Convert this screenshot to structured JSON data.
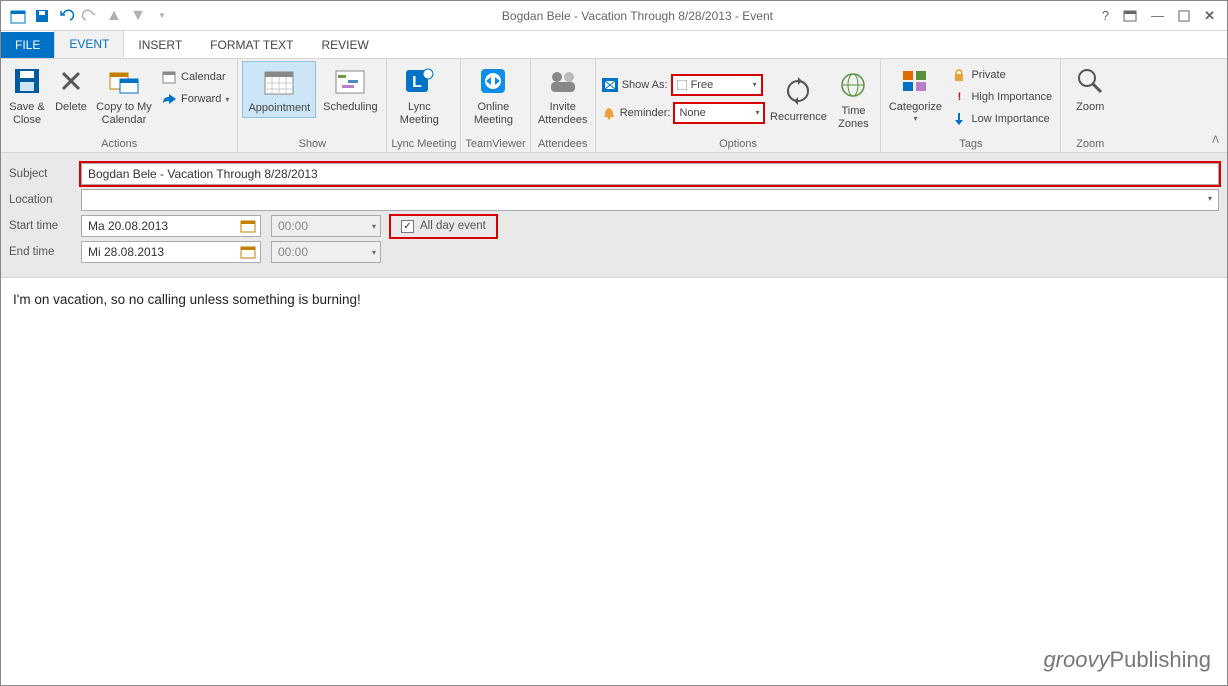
{
  "window": {
    "title": "Bogdan Bele - Vacation Through 8/28/2013 - Event"
  },
  "tabs": {
    "file": "FILE",
    "event": "EVENT",
    "insert": "INSERT",
    "format_text": "FORMAT TEXT",
    "review": "REVIEW"
  },
  "ribbon": {
    "actions": {
      "save_close": "Save & Close",
      "delete": "Delete",
      "copy_cal": "Copy to My Calendar",
      "calendar": "Calendar",
      "forward": "Forward",
      "group": "Actions"
    },
    "show": {
      "appointment": "Appointment",
      "scheduling": "Scheduling",
      "group": "Show"
    },
    "lync": {
      "label": "Lync Meeting",
      "group": "Lync Meeting"
    },
    "online": {
      "label": "Online Meeting",
      "group": "TeamViewer"
    },
    "attendees": {
      "label": "Invite Attendees",
      "group": "Attendees"
    },
    "options": {
      "show_as_label": "Show As:",
      "show_as_value": "Free",
      "reminder_label": "Reminder:",
      "reminder_value": "None",
      "recurrence": "Recurrence",
      "time_zones": "Time Zones",
      "group": "Options"
    },
    "tags": {
      "categorize": "Categorize",
      "private": "Private",
      "high": "High Importance",
      "low": "Low Importance",
      "group": "Tags"
    },
    "zoom": {
      "label": "Zoom",
      "group": "Zoom"
    }
  },
  "form": {
    "subject_label": "Subject",
    "subject_value": "Bogdan Bele - Vacation Through 8/28/2013",
    "location_label": "Location",
    "location_value": "",
    "start_label": "Start time",
    "start_date": "Ma 20.08.2013",
    "start_time": "00:00",
    "end_label": "End time",
    "end_date": "Mi 28.08.2013",
    "end_time": "00:00",
    "all_day_label": "All day event",
    "all_day_checked": true
  },
  "body_text": "I'm on vacation, so no calling unless something is burning!",
  "watermark": {
    "a": "groovy",
    "b": "Publishing"
  }
}
